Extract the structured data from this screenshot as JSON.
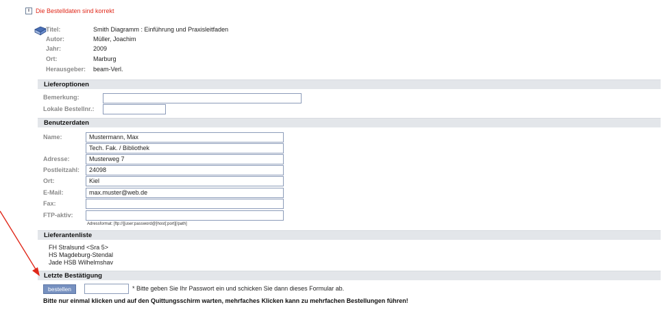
{
  "banner": "Die Bestelldaten sind korrekt",
  "info_icon": "i",
  "book": {
    "labels": {
      "title": "Titel:",
      "author": "Autor:",
      "year": "Jahr:",
      "place": "Ort:",
      "publisher": "Herausgeber:"
    },
    "values": {
      "title": "Smith Diagramm : Einführung und Praxisleitfaden",
      "author": "Müller, Joachim",
      "year": "2009",
      "place": "Marburg",
      "publisher": "beam-Verl."
    }
  },
  "sections": {
    "delivery": "Lieferoptionen",
    "user": "Benutzerdaten",
    "suppliers": "Lieferantenliste",
    "confirm": "Letzte Bestätigung"
  },
  "delivery": {
    "remark_label": "Bemerkung:",
    "remark_value": "",
    "local_order_label": "Lokale Bestellnr.:",
    "local_order_value": ""
  },
  "user": {
    "name_label": "Name:",
    "name_value": "Mustermann, Max",
    "institution_value": "Tech. Fak. / Bibliothek",
    "address_label": "Adresse:",
    "address_value": "Musterweg 7",
    "zip_label": "Postleitzahl:",
    "zip_value": "24098",
    "city_label": "Ort:",
    "city_value": "Kiel",
    "email_label": "E-Mail:",
    "email_value": "max.muster@web.de",
    "fax_label": "Fax:",
    "fax_value": "",
    "ftp_label": "FTP-aktiv:",
    "ftp_value": "",
    "ftp_hint": "Adressformat: [ftp://][user:password@]host[:port][/path]"
  },
  "suppliers": [
    "FH Stralsund <Sra 5>",
    "HS Magdeburg-Stendal",
    "Jade HSB Wilhelmshav"
  ],
  "confirm": {
    "button_label": "bestellen",
    "password_value": "",
    "hint": "* Bitte geben Sie Ihr Passwort ein und schicken Sie dann dieses Formular ab.",
    "warning": "Bitte nur einmal klicken und auf den Quittungsschirm warten, mehrfaches Klicken kann zu mehrfachen Bestellungen führen!"
  },
  "colors": {
    "accent": "#e0281a",
    "section_bg": "#e3e6ea",
    "button": "#7791c0",
    "arrow": "#e0281a"
  }
}
